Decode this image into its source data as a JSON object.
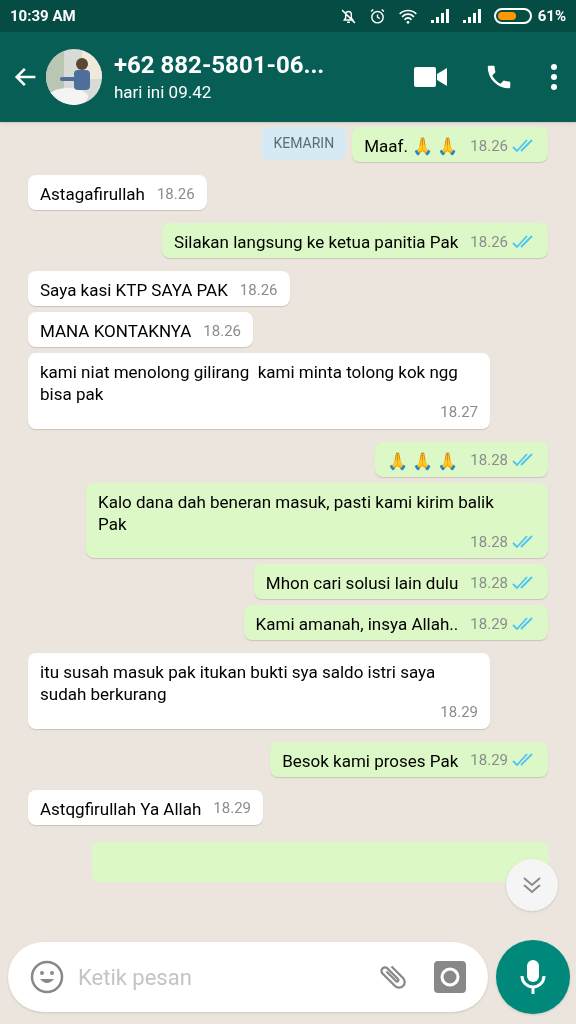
{
  "status_bar": {
    "time": "10:39 AM",
    "battery_text": "61%"
  },
  "header": {
    "name": "+62 882-5801-06...",
    "last_seen": "hari ini 09.42"
  },
  "date_chip": "KEMARIN",
  "messages": [
    {
      "kind": "outgoing",
      "text": "Maaf. 🙏 🙏",
      "time": "18.26",
      "read": true
    },
    {
      "kind": "incoming",
      "text": "Astagafirullah",
      "time": "18.26"
    },
    {
      "kind": "outgoing",
      "text": "Silakan langsung ke ketua panitia Pak",
      "time": "18.26",
      "read": true
    },
    {
      "kind": "incoming",
      "text": "Saya kasi KTP SAYA PAK",
      "time": "18.26"
    },
    {
      "kind": "incoming",
      "text": "MANA KONTAKNYA",
      "time": "18.26"
    },
    {
      "kind": "incoming",
      "text": "kami niat menolong gilirang  kami minta tolong kok ngg bisa pak",
      "time": "18.27"
    },
    {
      "kind": "outgoing",
      "text": "🙏 🙏 🙏",
      "time": "18.28",
      "read": true
    },
    {
      "kind": "outgoing",
      "text": "Kalo dana dah beneran masuk, pasti kami kirim balik Pak",
      "time": "18.28",
      "read": true
    },
    {
      "kind": "outgoing",
      "text": "Mhon cari solusi lain dulu",
      "time": "18.28",
      "read": true
    },
    {
      "kind": "outgoing",
      "text": "Kami amanah, insya Allah..",
      "time": "18.29",
      "read": true
    },
    {
      "kind": "incoming",
      "text": "itu susah masuk pak itukan bukti sya saldo istri saya sudah berkurang",
      "time": "18.29"
    },
    {
      "kind": "outgoing",
      "text": "Besok kami proses Pak",
      "time": "18.29",
      "read": true
    },
    {
      "kind": "incoming",
      "text": "Astqgfirullah Ya Allah",
      "time": "18.29"
    }
  ],
  "composer": {
    "placeholder": "Ketik pesan"
  }
}
